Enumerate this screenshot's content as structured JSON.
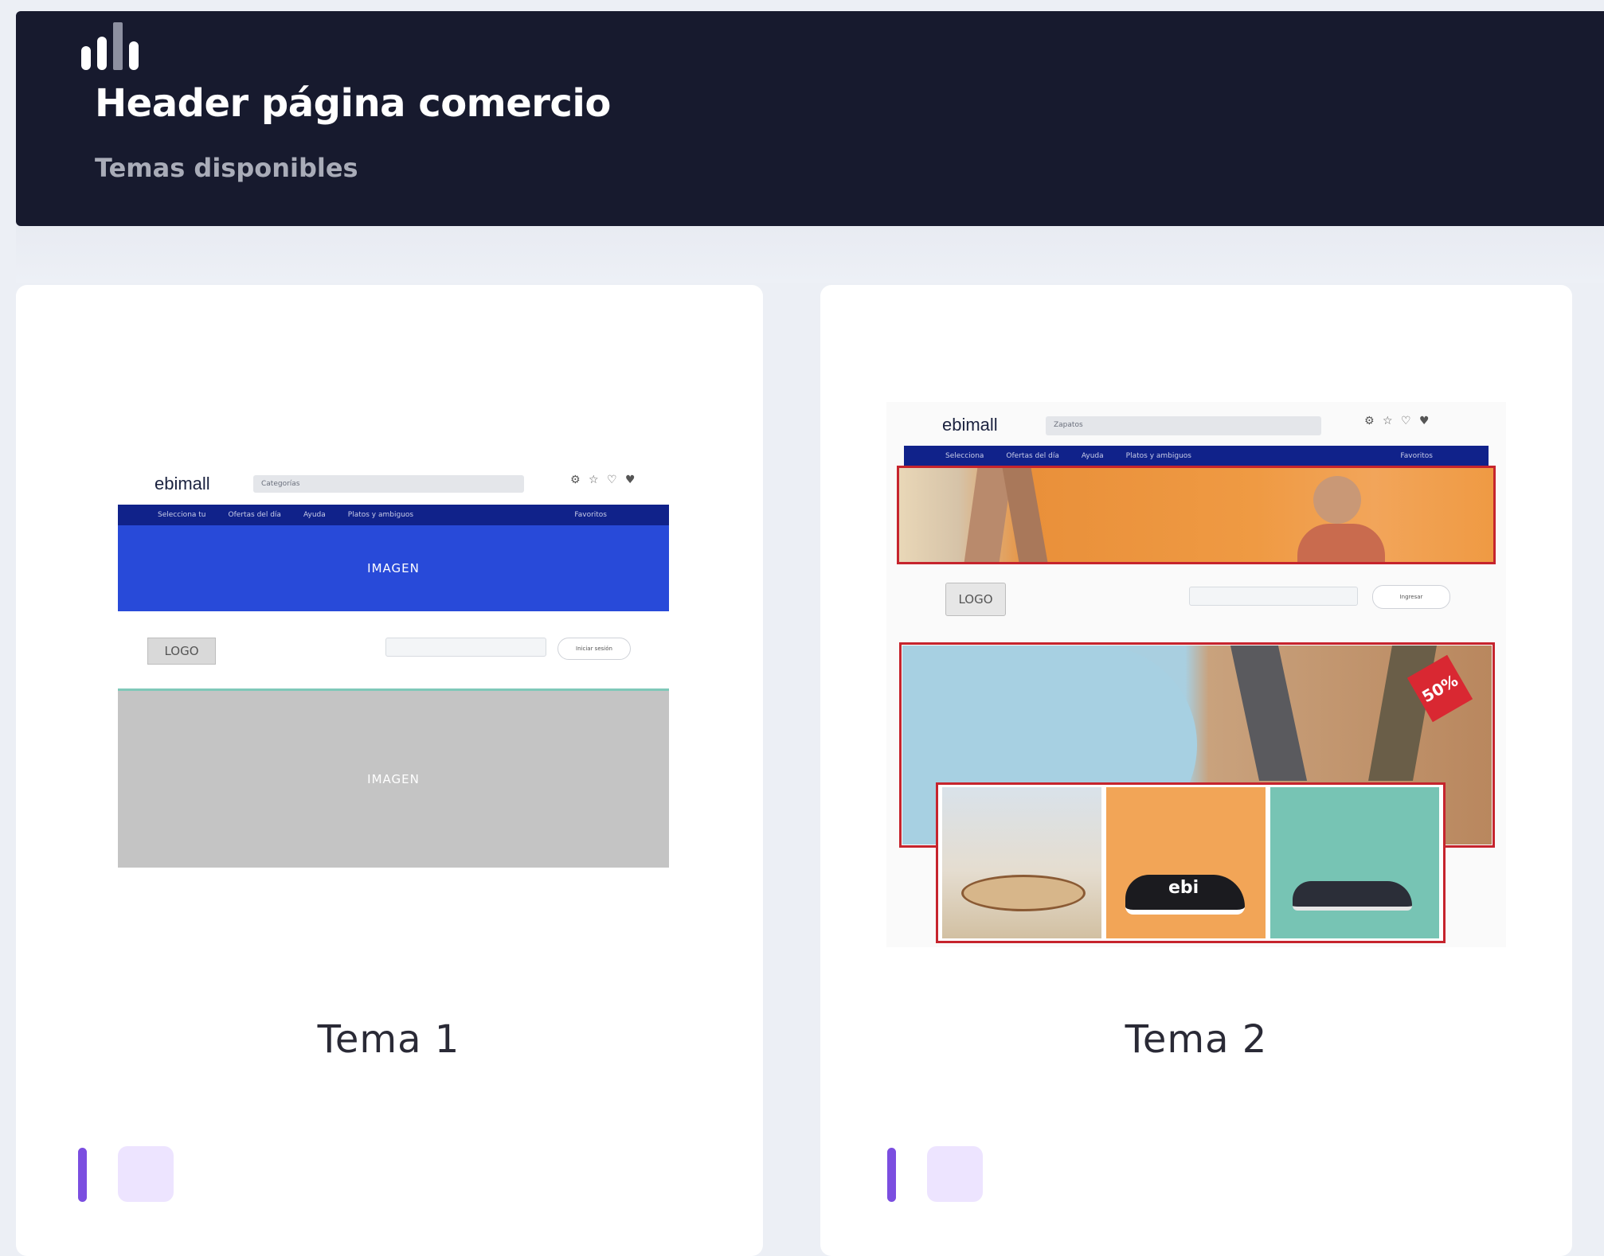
{
  "header": {
    "title": "Header página comercio",
    "subtitle": "Temas disponibles",
    "icon": "bar-chart-icon"
  },
  "themes": [
    {
      "name": "Tema 1",
      "preview": {
        "brand": "ebimall",
        "search_category": "Categorías",
        "nav_items": [
          "Selecciona tu",
          "Ofertas del día",
          "Ayuda",
          "Platos y ambiguos"
        ],
        "nav_right": "Favoritos",
        "image_label_1": "IMAGEN",
        "logo_label": "LOGO",
        "pill_label": "Iniciar sesión",
        "image_label_2": "IMAGEN"
      }
    },
    {
      "name": "Tema 2",
      "preview": {
        "brand": "ebimall",
        "search_category": "Zapatos",
        "nav_items": [
          "Selecciona",
          "Ofertas del día",
          "Ayuda",
          "Platos y ambiguos"
        ],
        "nav_right": "Favoritos",
        "logo_label": "LOGO",
        "pill_label": "Ingresar",
        "sale_badge": "50%",
        "shoe_brand": "ebi"
      }
    }
  ],
  "colors": {
    "header_bg": "#171a2e",
    "accent": "#7b4ee0",
    "nav_blue": "#10228a",
    "image_blue": "#284ad9",
    "frame_red": "#c6242d"
  }
}
